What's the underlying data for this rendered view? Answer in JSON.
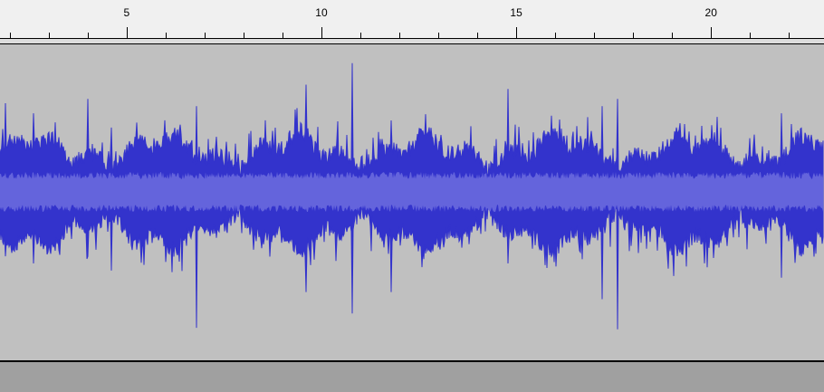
{
  "ruler": {
    "unit": "seconds",
    "major_labels": [
      "5",
      "10",
      "15",
      "20"
    ],
    "major_values": [
      5,
      10,
      15,
      20
    ],
    "visible_range": [
      1.75,
      22.9
    ],
    "minor_step": 1
  },
  "track": {
    "background_color": "#c0c0c0",
    "waveform_color": "#3333cc",
    "rms_color": "#6464dc",
    "peak_spikes": [
      {
        "t": 1.9,
        "up": 0.62,
        "down": 0.45
      },
      {
        "t": 2.6,
        "up": 0.55,
        "down": 0.5
      },
      {
        "t": 4.0,
        "up": 0.65,
        "down": 0.45
      },
      {
        "t": 4.6,
        "up": 0.45,
        "down": 0.55
      },
      {
        "t": 6.8,
        "up": 0.6,
        "down": 0.95
      },
      {
        "t": 9.6,
        "up": 0.75,
        "down": 0.7
      },
      {
        "t": 10.8,
        "up": 0.9,
        "down": 0.85
      },
      {
        "t": 11.8,
        "up": 0.5,
        "down": 0.7
      },
      {
        "t": 14.8,
        "up": 0.72,
        "down": 0.5
      },
      {
        "t": 17.2,
        "up": 0.6,
        "down": 0.75
      },
      {
        "t": 17.6,
        "up": 0.65,
        "down": 0.96
      },
      {
        "t": 21.8,
        "up": 0.55,
        "down": 0.6
      }
    ]
  }
}
